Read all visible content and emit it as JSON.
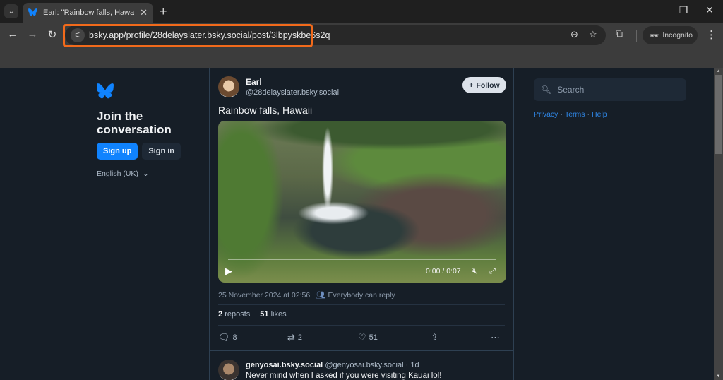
{
  "browser": {
    "tab_title": "Earl: \"Rainbow falls, Hawaii\" — Bluesky",
    "url": "bsky.app/profile/28delaysl​ater.bsky.social/post/3lbpyskbe6s2q",
    "incognito_label": "Incognito",
    "icons": {
      "tab_search": "chevron-down-icon",
      "favicon": "butterfly-icon",
      "close_tab": "close-icon",
      "new_tab": "plus-icon",
      "minimize": "minimize-icon",
      "restore": "restore-icon",
      "close_window": "close-icon",
      "back": "arrow-left-icon",
      "forward": "arrow-right-icon",
      "reload": "reload-icon",
      "site_info": "tune-icon",
      "zoom": "zoom-out-icon",
      "bookmark": "star-icon",
      "extensions": "puzzle-icon",
      "incognito": "incognito-icon",
      "menu": "kebab-icon"
    },
    "highlight_color": "#f26a1b"
  },
  "sidebar": {
    "title": "Join the conversation",
    "signup_label": "Sign up",
    "signin_label": "Sign in",
    "language": "English (UK)",
    "brand_color": "#1083fe"
  },
  "post": {
    "author_name": "Earl",
    "author_handle": "@28delayslater.bsky.social",
    "follow_label": "Follow",
    "text": "Rainbow falls, Hawaii",
    "video": {
      "time": "0:00 / 0:07",
      "progress": 0
    },
    "timestamp": "25 November 2024 at 02:56",
    "reply_permission": "Everybody can reply",
    "reposts_count": "2",
    "reposts_label": "reposts",
    "likes_count": "51",
    "likes_label": "likes",
    "actions": {
      "replies": "8",
      "reposts": "2",
      "likes": "51"
    }
  },
  "reply": {
    "display_name": "genyosai.bsky.social",
    "handle": "@genyosai.bsky.social",
    "age": "· 1d",
    "text": "Never mind when I asked if you were visiting Kauai lol!"
  },
  "right": {
    "search_placeholder": "Search",
    "links": [
      "Privacy",
      "Terms",
      "Help"
    ]
  }
}
